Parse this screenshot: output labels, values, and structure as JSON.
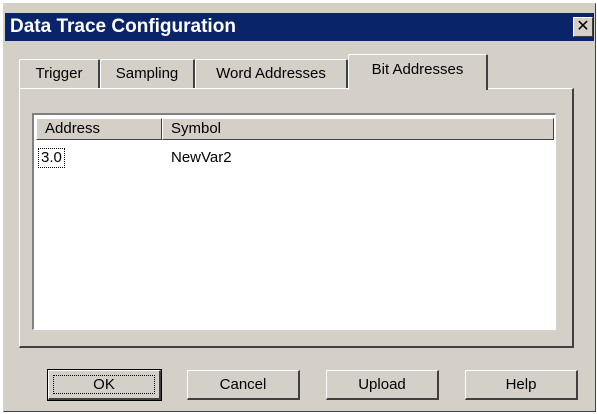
{
  "window": {
    "title": "Data Trace Configuration",
    "close_glyph": "✕"
  },
  "tabs": [
    {
      "label": "Trigger",
      "active": false
    },
    {
      "label": "Sampling",
      "active": false
    },
    {
      "label": "Word Addresses",
      "active": false
    },
    {
      "label": "Bit Addresses",
      "active": true
    }
  ],
  "list": {
    "columns": [
      "Address",
      "Symbol"
    ],
    "rows": [
      {
        "address": "3.0",
        "symbol": "NewVar2"
      }
    ]
  },
  "buttons": {
    "ok": "OK",
    "cancel": "Cancel",
    "upload": "Upload",
    "help": "Help"
  }
}
